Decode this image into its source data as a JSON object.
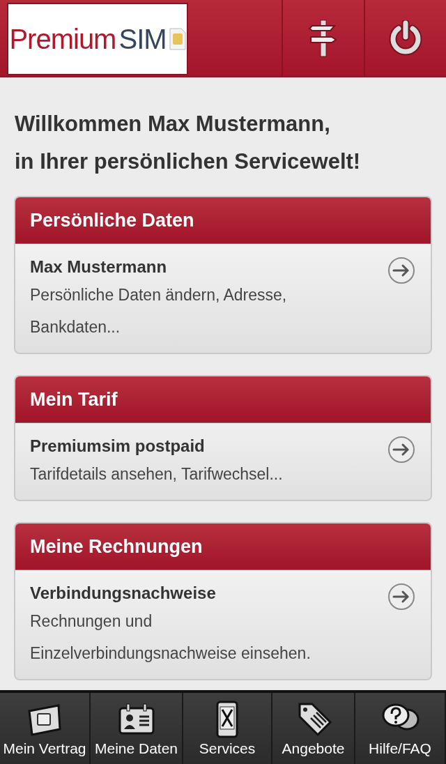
{
  "header": {
    "logo": {
      "primary": "Premium",
      "secondary": "SIM"
    }
  },
  "greeting": [
    "Willkommen Max Mustermann,",
    "in Ihrer persönlichen Servicewelt!"
  ],
  "cards": [
    {
      "heading": "Persönliche Daten",
      "title": "Max Mustermann",
      "description": "Persönliche Daten ändern, Adresse, Bankdaten..."
    },
    {
      "heading": "Mein Tarif",
      "title": "Premiumsim postpaid",
      "description": "Tarifdetails ansehen, Tarifwechsel..."
    },
    {
      "heading": "Meine Rechnungen",
      "title": "Verbindungsnachweise",
      "description": "Rechnungen und Einzelverbindungsnachweise einsehen."
    }
  ],
  "tab_bar": [
    {
      "label": "Mein Vertrag",
      "kind": "sim"
    },
    {
      "label": "Meine Daten",
      "kind": "id"
    },
    {
      "label": "Services",
      "kind": "phone"
    },
    {
      "label": "Angebote",
      "kind": "tag"
    },
    {
      "label": "Hilfe/FAQ",
      "kind": "help"
    }
  ]
}
